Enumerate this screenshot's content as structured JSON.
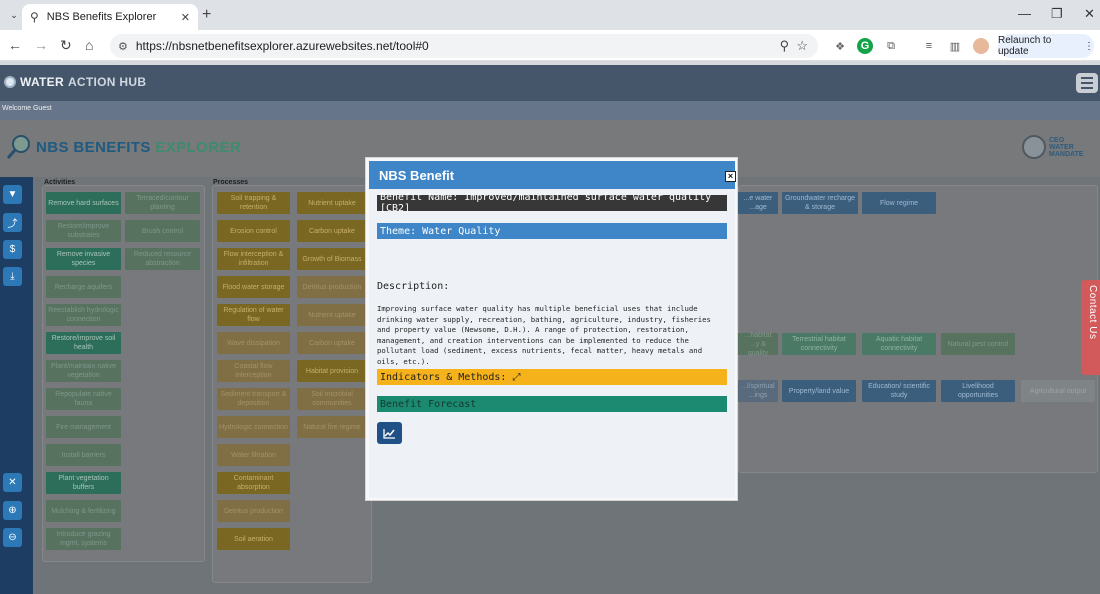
{
  "browser": {
    "tab_title": "NBS Benefits Explorer",
    "url": "https://nbsnetbenefitsexplorer.azurewebsites.net/tool#0",
    "relaunch_label": "Relaunch to update"
  },
  "site": {
    "hub_name_1": "WATER",
    "hub_name_2": "ACTION HUB",
    "welcome": "Welcome Guest",
    "title_1": "NBS BENEFITS",
    "title_2": "EXPLORER",
    "ceo_1": "CEO",
    "ceo_2": "WATER",
    "ceo_3": "MANDATE",
    "contact": "Contact Us"
  },
  "panels": {
    "activities_label": "Activities",
    "processes_label": "Processes"
  },
  "activities": [
    "Remove hard surfaces",
    "Terraced/contour planting",
    "Restore/improve substrates",
    "Brush control",
    "Remove invasive species",
    "Reduced resource abstraction",
    "Recharge aquifers",
    "Reestablish hydrologic connection",
    "Restore/improve soil health",
    "Plant/maintain native vegetation",
    "Repopulate native fauna",
    "Fire management",
    "Install barriers",
    "Plant vegetation buffers",
    "Mulching & fertilizing",
    "Introduce grazing mgmt. systems"
  ],
  "processes": [
    "Soil trapping & retention",
    "Nutrient uptake",
    "Erosion control",
    "Carbon uptake",
    "Flow interception & infiltration",
    "Growth of Biomass",
    "Flood water storage",
    "Detritus production",
    "Regulation of water flow",
    "Nutrient uptake",
    "Wave dissipation",
    "Carbon uptake",
    "Coastal flow interception",
    "Habitat provision",
    "Sediment transport & deposition",
    "Soil microbial communities",
    "Hydrologic connection",
    "Natural fire regime",
    "Water filtration",
    "Contaminant absorption",
    "Detritus production",
    "Soil aeration"
  ],
  "benefits": {
    "row1": [
      "...e water ...age",
      "Groundwater recharge & storage",
      "Flow regime"
    ],
    "row2": [
      "...habitat ...y & quality",
      "Terrestrial habitat connectivity",
      "Aquatic habitat connectivity",
      "Natural pest control"
    ],
    "row3": [
      "...l/spiritual ...ings",
      "Property/land value",
      "Education/ scientific study",
      "Livelihood opportunities",
      "Agricultural output"
    ]
  },
  "modal": {
    "title": "NBS Benefit",
    "close": "×",
    "benefit_name": "Benefit Name: Improved/maintained surface water quality [CB2]",
    "theme": "Theme: Water Quality",
    "description_label": "Description:",
    "description": "Improving surface water quality has multiple beneficial uses that include drinking water supply, recreation, bathing, agriculture, industry, fisheries and property value (Newsome, D.H.). A range of protection, restoration, management, and creation interventions can be implemented to reduce the pollutant load (sediment, excess nutrients, fecal matter, heavy metals and oils, etc.).",
    "indicators": "Indicators & Methods: ⤢",
    "forecast": "Benefit Forecast"
  }
}
